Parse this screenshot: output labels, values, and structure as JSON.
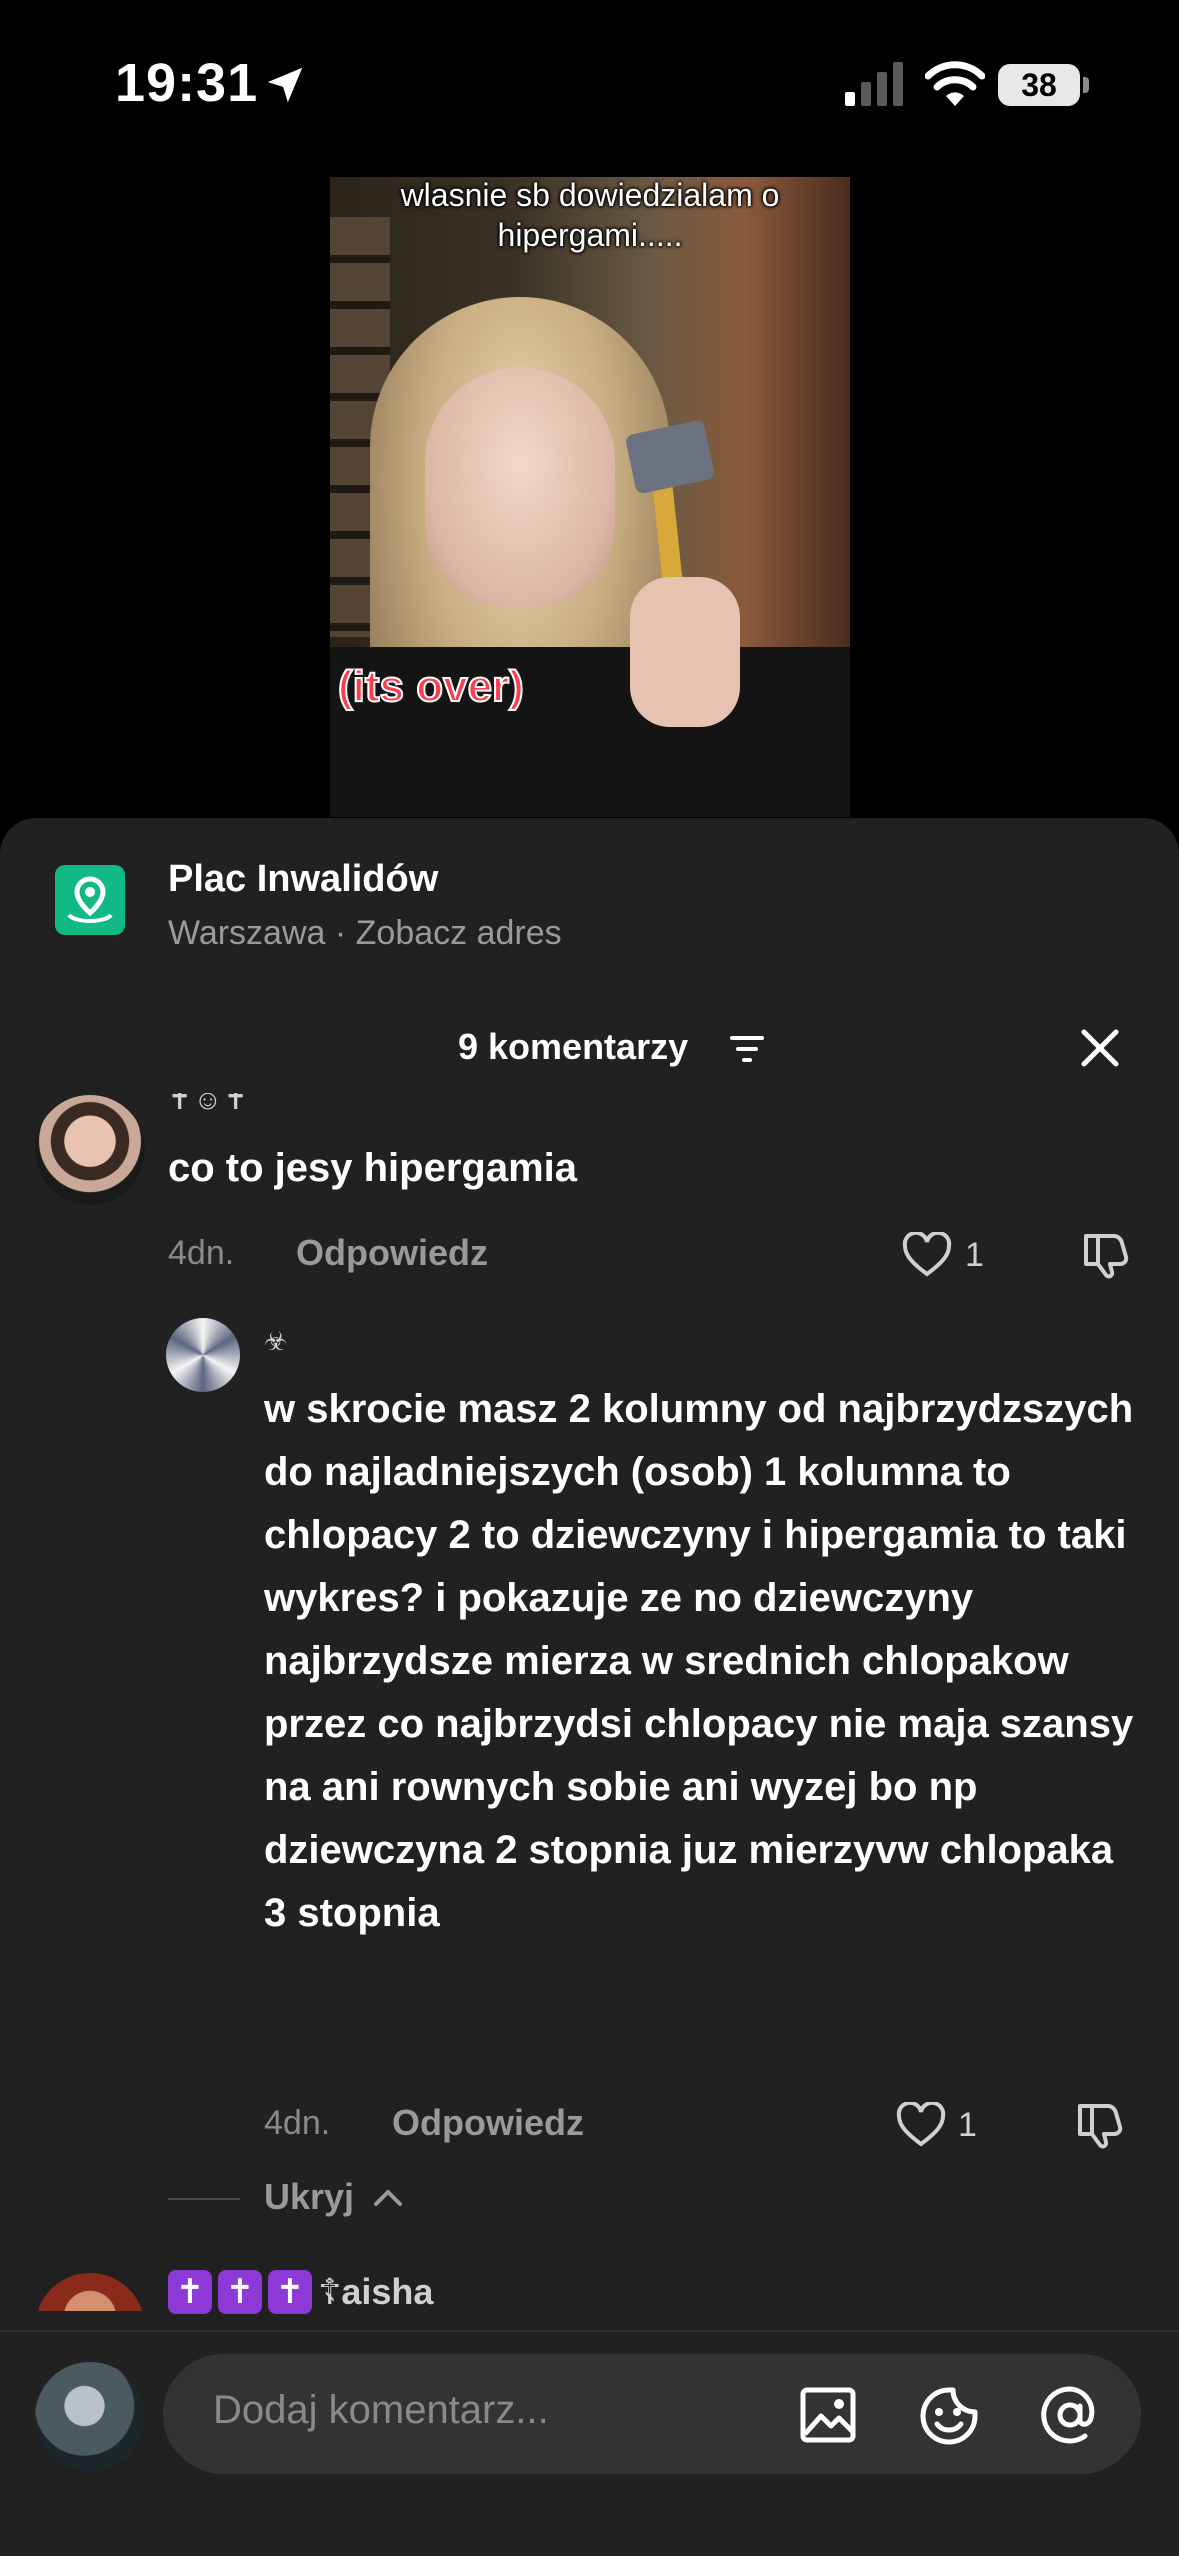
{
  "status": {
    "time": "19:31",
    "battery": "38"
  },
  "video": {
    "caption_top": "wlasnie sb dowiedzialam o hipergami.....",
    "caption_over": "(its over)"
  },
  "location": {
    "name": "Plac Inwalidów",
    "subtitle": "Warszawa · Zobacz adres"
  },
  "comments_header": {
    "title": "9 komentarzy"
  },
  "comments": [
    {
      "username": "✝︎☺︎✝︎",
      "text": "co to jesy hipergamia",
      "time": "4dn.",
      "reply_label": "Odpowiedz",
      "likes": "1"
    },
    {
      "username": "☣︎",
      "text": "w skrocie masz 2 kolumny od najbrzydzszych do najladniejszych (osob) 1 kolumna to chlopacy 2 to dziewczyny i hipergamia to taki wykres? i pokazuje ze no dziewczyny najbrzydsze mierza w srednich chlopakow przez co najbrzydsi chlopacy nie maja szansy na ani rownych sobie ani wyzej bo np dziewczyna 2 stopnia juz mierzyvw chlopaka 3 stopnia",
      "time": "4dn.",
      "reply_label": "Odpowiedz",
      "likes": "1"
    }
  ],
  "hide_label": "Ukryj",
  "third_comment": {
    "badges": [
      "✝",
      "✝",
      "✝"
    ],
    "username": "☦︎aisha"
  },
  "composer": {
    "placeholder": "Dodaj komentarz..."
  },
  "colors": {
    "sheet_bg": "#212121",
    "location_icon": "#13b985",
    "badge": "#8e3ad9"
  }
}
